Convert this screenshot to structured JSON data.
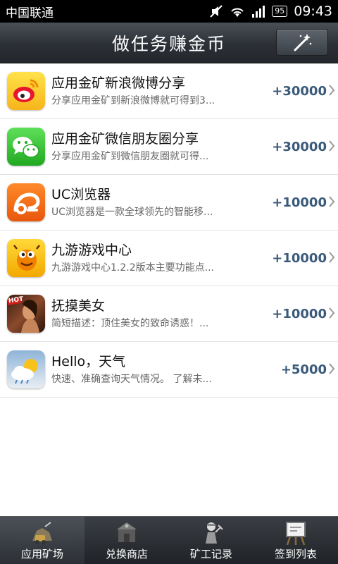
{
  "status_bar": {
    "carrier": "中国联通",
    "battery": "95",
    "time": "09:43"
  },
  "header": {
    "title": "做任务赚金币",
    "magic_icon": "magic-wand-icon"
  },
  "tasks": [
    {
      "title": "应用金矿新浪微博分享",
      "desc": "分享应用金矿到新浪微博就可得到3...",
      "reward": "+30000",
      "icon": "weibo-icon"
    },
    {
      "title": "应用金矿微信朋友圈分享",
      "desc": "分享应用金矿到微信朋友圈就可得...",
      "reward": "+30000",
      "icon": "wechat-icon"
    },
    {
      "title": "UC浏览器",
      "desc": "UC浏览器是一款全球领先的智能移...",
      "reward": "+10000",
      "icon": "uc-browser-icon"
    },
    {
      "title": "九游游戏中心",
      "desc": "九游游戏中心1.2.2版本主要功能点...",
      "reward": "+10000",
      "icon": "jiuyou-icon"
    },
    {
      "title": "抚摸美女",
      "desc": "简短描述：顶住美女的致命诱惑！...",
      "reward": "+10000",
      "icon": "hot-game-icon"
    },
    {
      "title": "Hello，天气",
      "desc": "快速、准确查询天气情况。 了解未...",
      "reward": "+5000",
      "icon": "weather-icon"
    }
  ],
  "tabs": [
    {
      "label": "应用矿场",
      "icon": "mine-icon",
      "active": true
    },
    {
      "label": "兑换商店",
      "icon": "shop-icon",
      "active": false
    },
    {
      "label": "矿工记录",
      "icon": "miner-record-icon",
      "active": false
    },
    {
      "label": "签到列表",
      "icon": "signin-board-icon",
      "active": false
    }
  ],
  "colors": {
    "reward": "#3a5a7a",
    "header_bg": "#2c3036",
    "tab_bg": "#1f2226"
  }
}
